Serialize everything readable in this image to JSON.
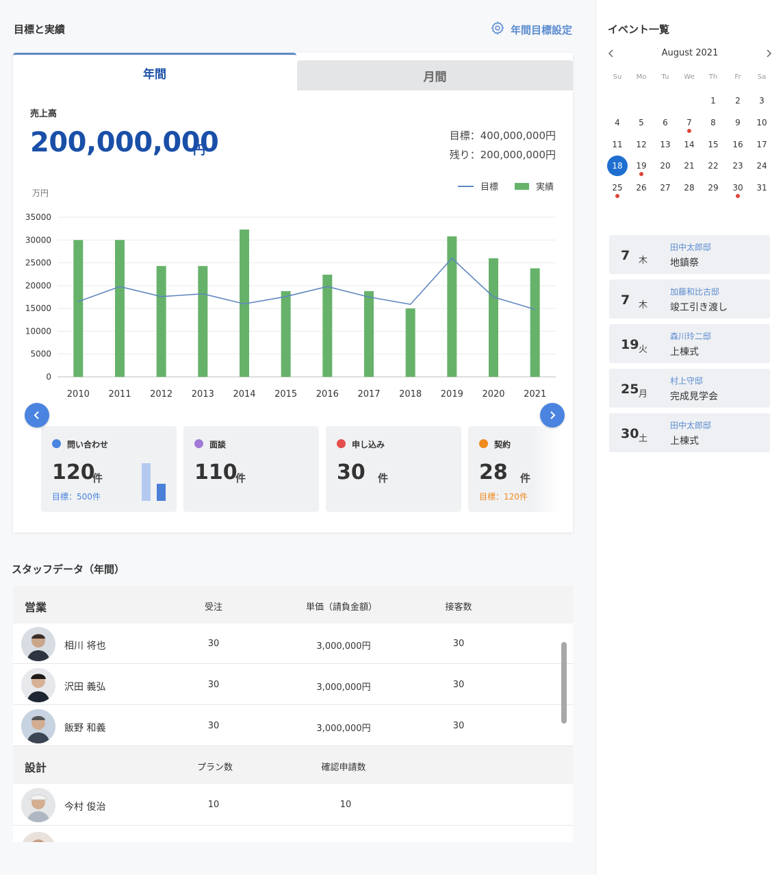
{
  "header": {
    "title": "目標と実績",
    "settings_label": "年間目標設定"
  },
  "tabs": {
    "year": "年間",
    "month": "月間"
  },
  "sales": {
    "label": "売上高",
    "value": "200,000,000",
    "unit": "円",
    "target": "目標：400,000,000円",
    "remaining": "残り：200,000,000円"
  },
  "chart_data": {
    "type": "bar",
    "ylabel": "万円",
    "ylim": [
      0,
      35000
    ],
    "yticks": [
      "35000",
      "30000",
      "25000",
      "20000",
      "15000",
      "10000",
      "5000",
      "0"
    ],
    "grid": true,
    "legend_position": "top-right",
    "categories": [
      "2010",
      "2011",
      "2012",
      "2013",
      "2014",
      "2015",
      "2016",
      "2017",
      "2018",
      "2019",
      "2020",
      "2021"
    ],
    "series": [
      {
        "name": "実績",
        "type": "bar",
        "color": "#66b26a",
        "values": [
          30000,
          30000,
          24300,
          24300,
          32300,
          18800,
          22400,
          18800,
          15000,
          30800,
          26000,
          23800
        ]
      },
      {
        "name": "目標",
        "type": "line",
        "color": "#5f86c0",
        "values": [
          16500,
          19800,
          17600,
          18200,
          16000,
          17600,
          19800,
          17500,
          15900,
          26000,
          17500,
          14800
        ]
      }
    ]
  },
  "kpis": [
    {
      "label": "問い合わせ",
      "value": "120",
      "unit": "件",
      "goal": "目標：500件",
      "color": "#4a84e0",
      "goal_color": "#4a84e0"
    },
    {
      "label": "面談",
      "value": "110",
      "unit": "件",
      "goal": "",
      "color": "#a07ad6",
      "goal_color": "#4a84e0"
    },
    {
      "label": "申し込み",
      "value": "30",
      "unit": "件",
      "goal": "",
      "color": "#e64d4d",
      "goal_color": "#4a84e0"
    },
    {
      "label": "契約",
      "value": "28",
      "unit": "件",
      "goal": "目標：120件",
      "color": "#ef8a1f",
      "goal_color": "#ef8a1f"
    }
  ],
  "staff": {
    "title": "スタッフデータ（年間）",
    "sales_group": {
      "title": "営業",
      "columns": [
        "受注",
        "単価（請負金額）",
        "接客数"
      ],
      "rows": [
        {
          "name": "相川 将也",
          "orders": "30",
          "price": "3,000,000円",
          "visitors": "30"
        },
        {
          "name": "沢田 義弘",
          "orders": "30",
          "price": "3,000,000円",
          "visitors": "30"
        },
        {
          "name": "飯野 和義",
          "orders": "30",
          "price": "3,000,000円",
          "visitors": "30"
        }
      ]
    },
    "design_group": {
      "title": "設計",
      "columns": [
        "プラン数",
        "確認申請数"
      ],
      "rows": [
        {
          "name": "今村 俊治",
          "plans": "10",
          "applications": "10"
        }
      ]
    }
  },
  "sidebar": {
    "title": "イベント一覧",
    "calendar": {
      "month": "August 2021",
      "weekdays": [
        "Su",
        "Mo",
        "Tu",
        "We",
        "Th",
        "Fr",
        "Sa"
      ],
      "first_weekday": 4,
      "days": 31,
      "selected": 18,
      "event_days": [
        7,
        19,
        25,
        30
      ]
    },
    "events": [
      {
        "day": "7",
        "weekday": "木",
        "house": "田中太郎邸",
        "title": "地鎮祭"
      },
      {
        "day": "7",
        "weekday": "木",
        "house": "加藤和比古邸",
        "title": "竣工引き渡し"
      },
      {
        "day": "19",
        "weekday": "火",
        "house": "森川玲二邸",
        "title": "上棟式"
      },
      {
        "day": "25",
        "weekday": "月",
        "house": "村上守邸",
        "title": "完成見学会"
      },
      {
        "day": "30",
        "weekday": "土",
        "house": "田中太郎邸",
        "title": "上棟式"
      }
    ]
  }
}
